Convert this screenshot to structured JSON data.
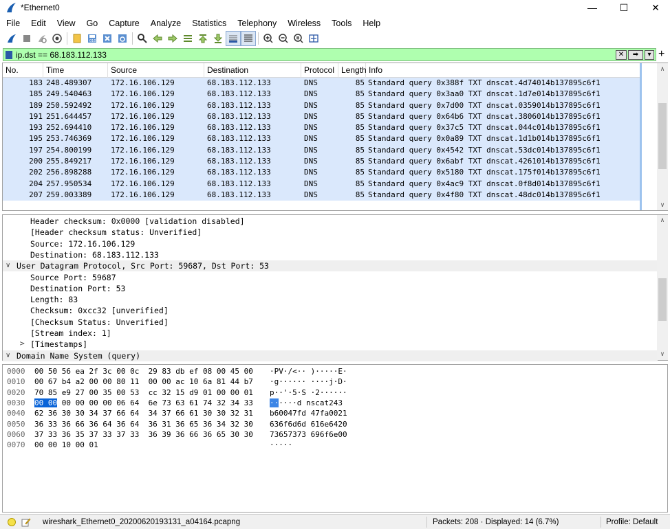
{
  "window": {
    "title": "*Ethernet0",
    "controls": [
      "—",
      "☐",
      "✕"
    ]
  },
  "menu": [
    "File",
    "Edit",
    "View",
    "Go",
    "Capture",
    "Analyze",
    "Statistics",
    "Telephony",
    "Wireless",
    "Tools",
    "Help"
  ],
  "toolbar": {
    "icons": [
      "start-capture-icon",
      "stop-capture-icon",
      "restart-capture-icon",
      "capture-options-icon",
      "open-file-icon",
      "save-file-icon",
      "close-file-icon",
      "reload-file-icon",
      "find-packet-icon",
      "go-back-icon",
      "go-forward-icon",
      "go-to-packet-icon",
      "go-first-icon",
      "go-last-icon",
      "autoscroll-icon",
      "colorize-icon",
      "zoom-in-icon",
      "zoom-out-icon",
      "zoom-normal-icon",
      "resize-columns-icon"
    ]
  },
  "filter": {
    "value": "ip.dst == 68.183.112.133",
    "accent": "#afffaf"
  },
  "packet_list": {
    "columns": [
      "No.",
      "Time",
      "Source",
      "Destination",
      "Protocol",
      "Length",
      "Info"
    ],
    "rows": [
      {
        "no": "183",
        "time": "248.489307",
        "src": "172.16.106.129",
        "dst": "68.183.112.133",
        "proto": "DNS",
        "len": "85",
        "info": "Standard query 0x388f TXT dnscat.4d74014b137895c6f1"
      },
      {
        "no": "185",
        "time": "249.540463",
        "src": "172.16.106.129",
        "dst": "68.183.112.133",
        "proto": "DNS",
        "len": "85",
        "info": "Standard query 0x3aa0 TXT dnscat.1d7e014b137895c6f1"
      },
      {
        "no": "189",
        "time": "250.592492",
        "src": "172.16.106.129",
        "dst": "68.183.112.133",
        "proto": "DNS",
        "len": "85",
        "info": "Standard query 0x7d00 TXT dnscat.0359014b137895c6f1"
      },
      {
        "no": "191",
        "time": "251.644457",
        "src": "172.16.106.129",
        "dst": "68.183.112.133",
        "proto": "DNS",
        "len": "85",
        "info": "Standard query 0x64b6 TXT dnscat.3806014b137895c6f1"
      },
      {
        "no": "193",
        "time": "252.694410",
        "src": "172.16.106.129",
        "dst": "68.183.112.133",
        "proto": "DNS",
        "len": "85",
        "info": "Standard query 0x37c5 TXT dnscat.044c014b137895c6f1"
      },
      {
        "no": "195",
        "time": "253.746369",
        "src": "172.16.106.129",
        "dst": "68.183.112.133",
        "proto": "DNS",
        "len": "85",
        "info": "Standard query 0x0a89 TXT dnscat.1d1b014b137895c6f1"
      },
      {
        "no": "197",
        "time": "254.800199",
        "src": "172.16.106.129",
        "dst": "68.183.112.133",
        "proto": "DNS",
        "len": "85",
        "info": "Standard query 0x4542 TXT dnscat.53dc014b137895c6f1"
      },
      {
        "no": "200",
        "time": "255.849217",
        "src": "172.16.106.129",
        "dst": "68.183.112.133",
        "proto": "DNS",
        "len": "85",
        "info": "Standard query 0x6abf TXT dnscat.4261014b137895c6f1"
      },
      {
        "no": "202",
        "time": "256.898288",
        "src": "172.16.106.129",
        "dst": "68.183.112.133",
        "proto": "DNS",
        "len": "85",
        "info": "Standard query 0x5180 TXT dnscat.175f014b137895c6f1"
      },
      {
        "no": "204",
        "time": "257.950534",
        "src": "172.16.106.129",
        "dst": "68.183.112.133",
        "proto": "DNS",
        "len": "85",
        "info": "Standard query 0x4ac9 TXT dnscat.0f8d014b137895c6f1"
      },
      {
        "no": "207",
        "time": "259.003389",
        "src": "172.16.106.129",
        "dst": "68.183.112.133",
        "proto": "DNS",
        "len": "85",
        "info": "Standard query 0x4f80 TXT dnscat.48dc014b137895c6f1"
      }
    ],
    "row_color": "#dae8fc"
  },
  "details": [
    {
      "text": "Header checksum: 0x0000 [validation disabled]",
      "indent": 2,
      "section": false,
      "expander": ""
    },
    {
      "text": "[Header checksum status: Unverified]",
      "indent": 2,
      "section": false,
      "expander": ""
    },
    {
      "text": "Source: 172.16.106.129",
      "indent": 2,
      "section": false,
      "expander": ""
    },
    {
      "text": "Destination: 68.183.112.133",
      "indent": 2,
      "section": false,
      "expander": ""
    },
    {
      "text": "User Datagram Protocol, Src Port: 59687, Dst Port: 53",
      "indent": 1,
      "section": true,
      "expander": "∨"
    },
    {
      "text": "Source Port: 59687",
      "indent": 2,
      "section": false,
      "expander": ""
    },
    {
      "text": "Destination Port: 53",
      "indent": 2,
      "section": false,
      "expander": ""
    },
    {
      "text": "Length: 83",
      "indent": 2,
      "section": false,
      "expander": ""
    },
    {
      "text": "Checksum: 0xcc32 [unverified]",
      "indent": 2,
      "section": false,
      "expander": ""
    },
    {
      "text": "[Checksum Status: Unverified]",
      "indent": 2,
      "section": false,
      "expander": ""
    },
    {
      "text": "[Stream index: 1]",
      "indent": 2,
      "section": false,
      "expander": ""
    },
    {
      "text": "[Timestamps]",
      "indent": 2,
      "section": false,
      "expander": ">"
    },
    {
      "text": "Domain Name System (query)",
      "indent": 1,
      "section": true,
      "expander": "∨"
    }
  ],
  "bytes": [
    {
      "off": "0000",
      "hex": "00 50 56 ea 2f 3c 00 0c  29 83 db ef 08 00 45 00",
      "ascii": "·PV·/<·· )·····E·"
    },
    {
      "off": "0010",
      "hex": "00 67 b4 a2 00 00 80 11  00 00 ac 10 6a 81 44 b7",
      "ascii": "·g······ ····j·D·"
    },
    {
      "off": "0020",
      "hex": "70 85 e9 27 00 35 00 53  cc 32 15 d9 01 00 00 01",
      "ascii": "p··'·5·S ·2······"
    },
    {
      "off": "0030",
      "hex_hl": "00 00",
      "hex": " 00 00 00 00 06 64  6e 73 63 61 74 32 34 33",
      "ascii_hl": "··",
      "ascii": "····d nscat243"
    },
    {
      "off": "0040",
      "hex": "62 36 30 30 34 37 66 64  34 37 66 61 30 30 32 31",
      "ascii": "b60047fd 47fa0021"
    },
    {
      "off": "0050",
      "hex": "36 33 36 66 36 64 36 64  36 31 36 65 36 34 32 30",
      "ascii": "636f6d6d 616e6420"
    },
    {
      "off": "0060",
      "hex": "37 33 36 35 37 33 37 33  36 39 36 66 36 65 30 30",
      "ascii": "73657373 696f6e00"
    },
    {
      "off": "0070",
      "hex": "00 00 10 00 01",
      "ascii": "·····"
    }
  ],
  "status": {
    "file": "wireshark_Ethernet0_20200620193131_a04164.pcapng",
    "packets": "Packets: 208 · Displayed: 14 (6.7%)",
    "profile": "Profile: Default"
  }
}
